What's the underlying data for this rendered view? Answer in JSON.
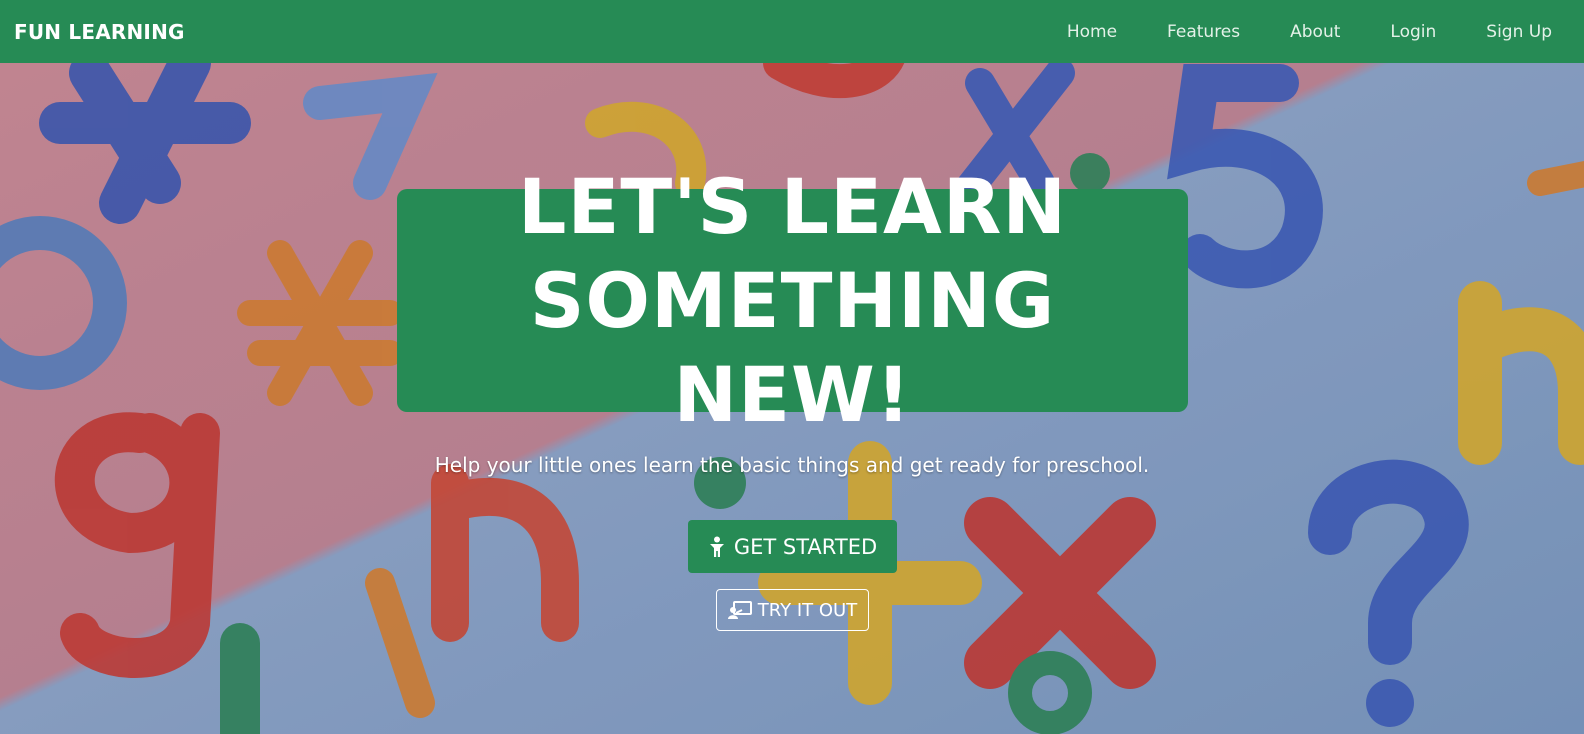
{
  "navbar": {
    "brand": "FUN LEARNING",
    "links": [
      {
        "label": "Home"
      },
      {
        "label": "Features"
      },
      {
        "label": "About"
      },
      {
        "label": "Login"
      },
      {
        "label": "Sign Up"
      }
    ]
  },
  "hero": {
    "headline_line1": "LET'S LEARN",
    "headline_line2": "SOMETHING NEW!",
    "subtitle": "Help your little ones learn the basic things and get ready for preschool.",
    "primary_button": {
      "label": "GET STARTED",
      "icon": "child-icon"
    },
    "secondary_button": {
      "label": "TRY IT OUT",
      "icon": "chalkboard-teacher-icon"
    },
    "background_image": "colorful-plastic-letters-and-numbers"
  },
  "colors": {
    "brand_green": "#268b55",
    "text_white": "#ffffff"
  }
}
